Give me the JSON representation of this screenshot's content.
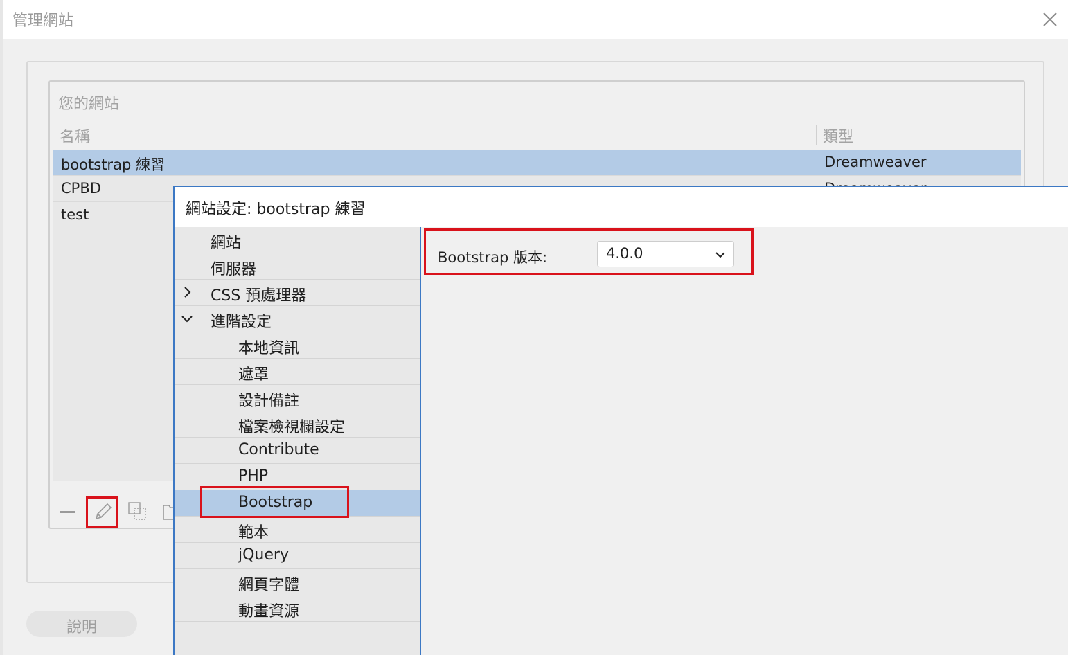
{
  "manage_sites": {
    "title": "管理網站",
    "close_icon": "close-icon",
    "your_sites_label": "您的網站",
    "columns": {
      "name": "名稱",
      "type": "類型"
    },
    "sites": [
      {
        "name": "bootstrap 練習",
        "type": "Dreamweaver",
        "selected": true
      },
      {
        "name": "CPBD",
        "type": "Dreamweaver",
        "selected": false
      },
      {
        "name": "test",
        "type": "",
        "selected": false
      }
    ],
    "toolbar_icons": [
      "minus-icon",
      "pencil-icon",
      "duplicate-icon",
      "folder-icon"
    ],
    "help_button": "說明"
  },
  "site_setup": {
    "title": "網站設定: bootstrap 練習",
    "nav": [
      {
        "label": "網站",
        "level": 0,
        "chevron": "",
        "selected": false
      },
      {
        "label": "伺服器",
        "level": 0,
        "chevron": "",
        "selected": false
      },
      {
        "label": "CSS 預處理器",
        "level": 0,
        "chevron": "right",
        "selected": false
      },
      {
        "label": "進階設定",
        "level": 0,
        "chevron": "down",
        "selected": false
      },
      {
        "label": "本地資訊",
        "level": 1,
        "chevron": "",
        "selected": false
      },
      {
        "label": "遮罩",
        "level": 1,
        "chevron": "",
        "selected": false
      },
      {
        "label": "設計備註",
        "level": 1,
        "chevron": "",
        "selected": false
      },
      {
        "label": "檔案檢視欄設定",
        "level": 1,
        "chevron": "",
        "selected": false
      },
      {
        "label": "Contribute",
        "level": 1,
        "chevron": "",
        "selected": false
      },
      {
        "label": "PHP",
        "level": 1,
        "chevron": "",
        "selected": false
      },
      {
        "label": "Bootstrap",
        "level": 1,
        "chevron": "",
        "selected": true
      },
      {
        "label": "範本",
        "level": 1,
        "chevron": "",
        "selected": false
      },
      {
        "label": "jQuery",
        "level": 1,
        "chevron": "",
        "selected": false
      },
      {
        "label": "網頁字體",
        "level": 1,
        "chevron": "",
        "selected": false
      },
      {
        "label": "動畫資源",
        "level": 1,
        "chevron": "",
        "selected": false
      }
    ],
    "bootstrap_version_label": "Bootstrap 版本:",
    "bootstrap_version_value": "4.0.0"
  },
  "colors": {
    "highlight_red": "#d9121b",
    "selection_blue": "#b3cbe6",
    "dialog_border_blue": "#3c78c4"
  }
}
